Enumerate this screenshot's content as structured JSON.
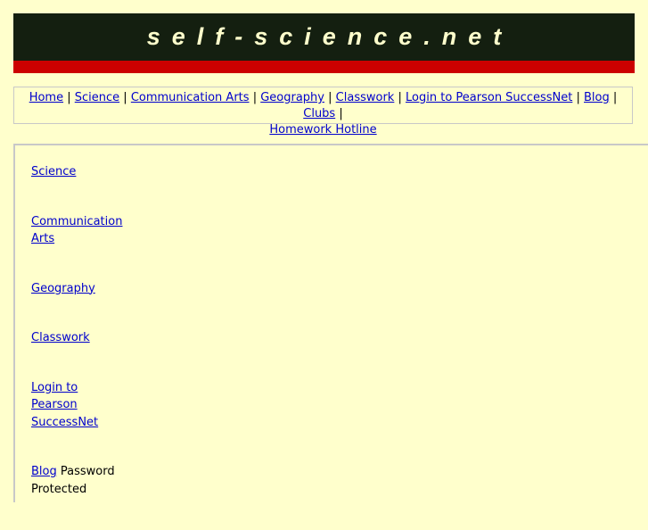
{
  "site": {
    "title": "self-science.net"
  },
  "topnav": {
    "links": [
      "Home",
      "Science",
      "Communication Arts",
      "Geography",
      "Classwork",
      "Login to Pearson SuccessNet",
      "Blog",
      "Clubs",
      "Homework Hotline"
    ],
    "separator": "|"
  },
  "sidebar": {
    "items": [
      {
        "label": "Science"
      },
      {
        "label": "Communication Arts"
      },
      {
        "label": "Geography"
      },
      {
        "label": "Classwork"
      },
      {
        "label": "Login to Pearson SuccessNet"
      },
      {
        "label": "Blog",
        "suffix": "Password Protected"
      }
    ]
  },
  "colors": {
    "banner_bg": "#141f10",
    "banner_stripe": "#cc0000",
    "page_bg": "#ffffcc",
    "link": "#0000cc"
  }
}
